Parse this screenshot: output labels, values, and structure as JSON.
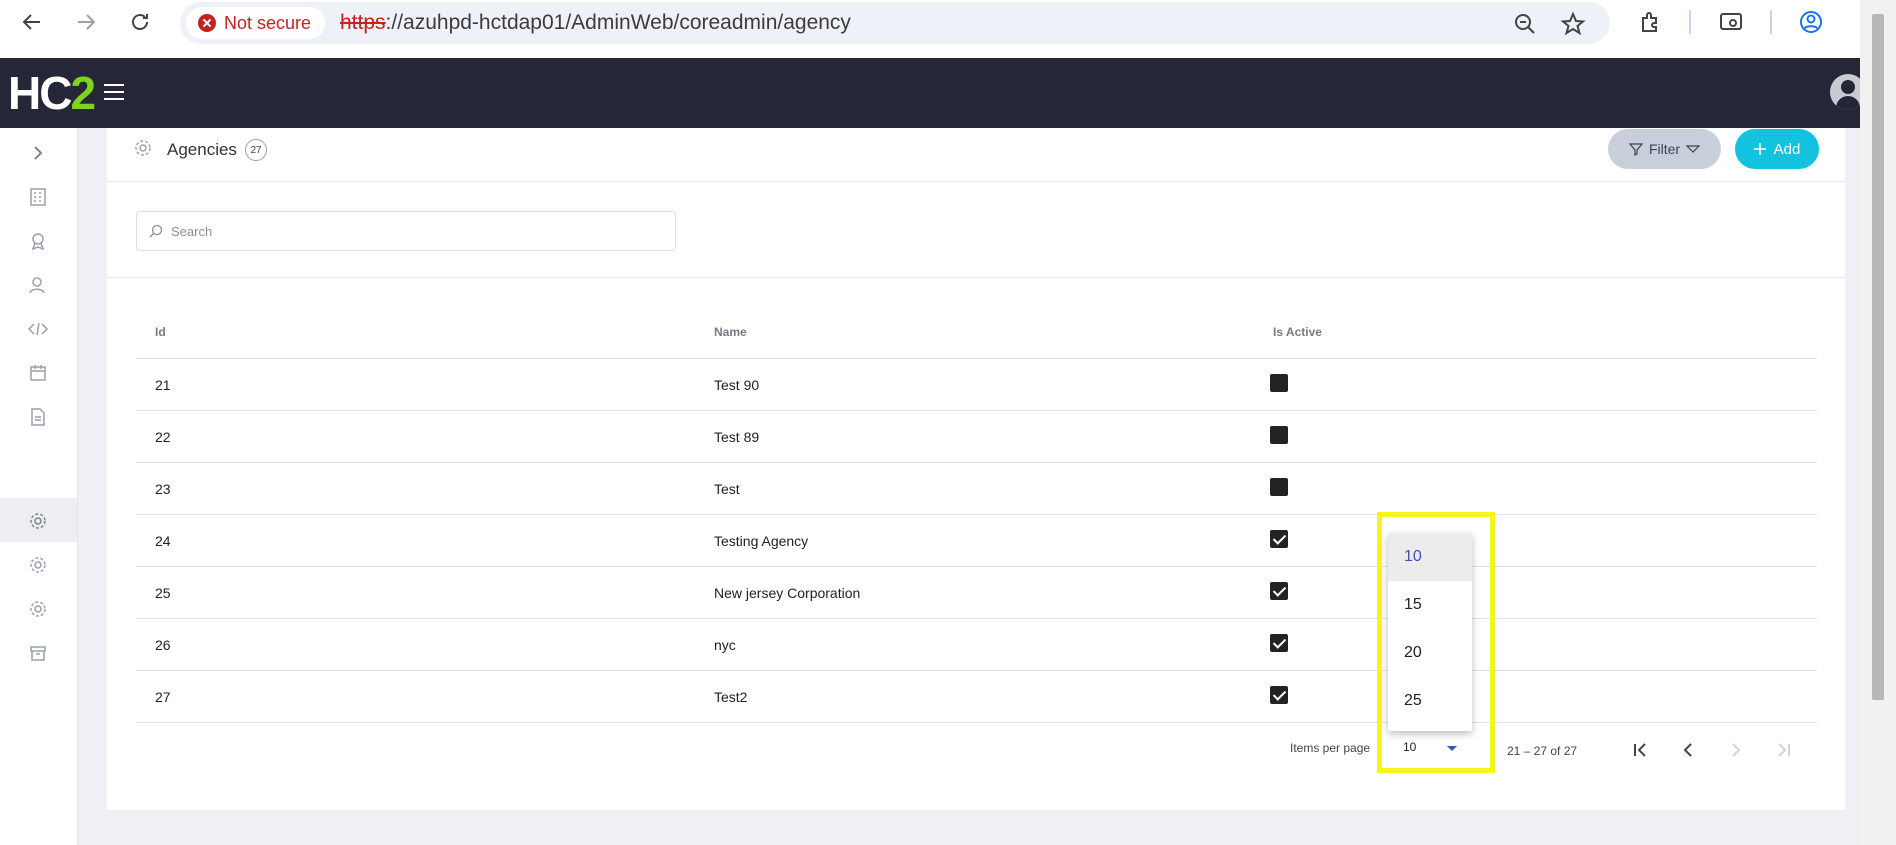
{
  "browser": {
    "security_label": "Not secure",
    "url_scheme": "https",
    "url_rest": "://azuhpd-hctdap01/AdminWeb/coreadmin/agency",
    "icons": [
      "back-arrow-icon",
      "forward-arrow-icon",
      "reload-icon",
      "zoom-icon",
      "bookmark-star-icon",
      "extensions-icon",
      "search-labs-icon",
      "profile-icon"
    ]
  },
  "app": {
    "logo_main": "HC",
    "logo_accent": "2",
    "accent_color": "#7ed321",
    "header_bg": "#252739"
  },
  "sidebar": {
    "icons": [
      "chevron-right-icon",
      "building-icon",
      "award-icon",
      "users-icon",
      "code-icon",
      "calendar-icon",
      "document-icon",
      "settings-icon",
      "settings-icon",
      "settings-icon",
      "archive-icon"
    ]
  },
  "page": {
    "title": "Agencies",
    "count": "27",
    "filter_label": "Filter",
    "add_label": "Add",
    "search_placeholder": "Search",
    "search_value": ""
  },
  "table": {
    "columns": [
      "Id",
      "Name",
      "Is Active"
    ],
    "rows": [
      {
        "id": "21",
        "name": "Test 90",
        "active": false
      },
      {
        "id": "22",
        "name": "Test 89",
        "active": false
      },
      {
        "id": "23",
        "name": "Test",
        "active": false
      },
      {
        "id": "24",
        "name": "Testing Agency",
        "active": true
      },
      {
        "id": "25",
        "name": "New jersey Corporation",
        "active": true
      },
      {
        "id": "26",
        "name": "nyc",
        "active": true
      },
      {
        "id": "27",
        "name": "Test2",
        "active": true
      }
    ]
  },
  "paginator": {
    "items_per_page_label": "Items per page",
    "selected": "10",
    "options": [
      "10",
      "15",
      "20",
      "25"
    ],
    "range_label": "21 – 27 of 27"
  }
}
